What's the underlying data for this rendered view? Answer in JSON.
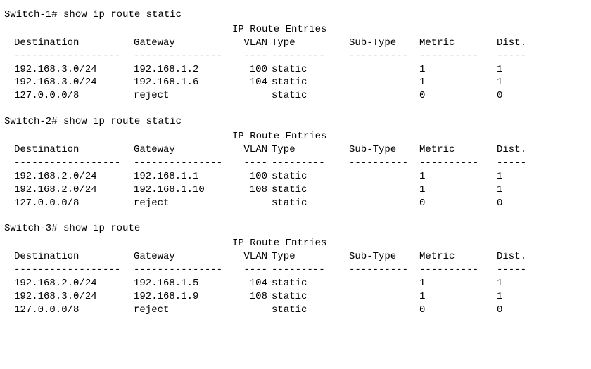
{
  "blocks": [
    {
      "prompt": "Switch-1#",
      "command": "show ip route static",
      "title": "IP Route Entries",
      "headers": {
        "dest": "Destination",
        "gw": "Gateway",
        "vlan": "VLAN",
        "type": "Type",
        "sub": "Sub-Type",
        "metric": "Metric",
        "dist": "Dist."
      },
      "dash": {
        "dest": "------------------",
        "gw": "---------------",
        "vlan": "----",
        "type": "---------",
        "sub": "----------",
        "metric": "----------",
        "dist": "-----"
      },
      "rows": [
        {
          "dest": "192.168.3.0/24",
          "gw": "192.168.1.2",
          "vlan": "100",
          "type": "static",
          "sub": "",
          "metric": "1",
          "dist": "1"
        },
        {
          "dest": "192.168.3.0/24",
          "gw": "192.168.1.6",
          "vlan": "104",
          "type": "static",
          "sub": "",
          "metric": "1",
          "dist": "1"
        },
        {
          "dest": "127.0.0.0/8",
          "gw": "reject",
          "vlan": "",
          "type": "static",
          "sub": "",
          "metric": "0",
          "dist": "0"
        }
      ]
    },
    {
      "prompt": "Switch-2#",
      "command": "show ip route static",
      "title": "IP Route Entries",
      "headers": {
        "dest": "Destination",
        "gw": "Gateway",
        "vlan": "VLAN",
        "type": "Type",
        "sub": "Sub-Type",
        "metric": "Metric",
        "dist": "Dist."
      },
      "dash": {
        "dest": "------------------",
        "gw": "---------------",
        "vlan": "----",
        "type": "---------",
        "sub": "----------",
        "metric": "----------",
        "dist": "-----"
      },
      "rows": [
        {
          "dest": "192.168.2.0/24",
          "gw": "192.168.1.1",
          "vlan": "100",
          "type": "static",
          "sub": "",
          "metric": "1",
          "dist": "1"
        },
        {
          "dest": "192.168.2.0/24",
          "gw": "192.168.1.10",
          "vlan": "108",
          "type": "static",
          "sub": "",
          "metric": "1",
          "dist": "1"
        },
        {
          "dest": "127.0.0.0/8",
          "gw": "reject",
          "vlan": "",
          "type": "static",
          "sub": "",
          "metric": "0",
          "dist": "0"
        }
      ]
    },
    {
      "prompt": "Switch-3#",
      "command": "show ip route",
      "title": "IP Route Entries",
      "headers": {
        "dest": "Destination",
        "gw": "Gateway",
        "vlan": "VLAN",
        "type": "Type",
        "sub": "Sub-Type",
        "metric": "Metric",
        "dist": "Dist."
      },
      "dash": {
        "dest": "------------------",
        "gw": "---------------",
        "vlan": "----",
        "type": "---------",
        "sub": "----------",
        "metric": "----------",
        "dist": "-----"
      },
      "rows": [
        {
          "dest": "192.168.2.0/24",
          "gw": "192.168.1.5",
          "vlan": "104",
          "type": "static",
          "sub": "",
          "metric": "1",
          "dist": "1"
        },
        {
          "dest": "192.168.3.0/24",
          "gw": "192.168.1.9",
          "vlan": "108",
          "type": "static",
          "sub": "",
          "metric": "1",
          "dist": "1"
        },
        {
          "dest": "127.0.0.0/8",
          "gw": "reject",
          "vlan": "",
          "type": "static",
          "sub": "",
          "metric": "0",
          "dist": "0"
        }
      ]
    }
  ]
}
